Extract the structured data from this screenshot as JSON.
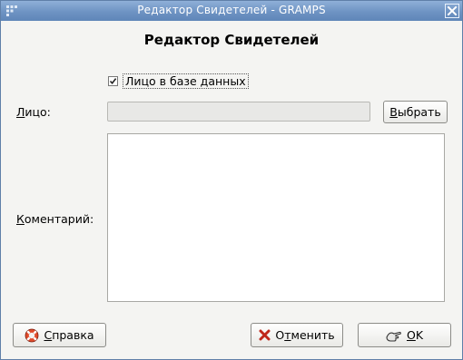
{
  "window": {
    "title": "Редактор Свидетелей - GRAMPS",
    "menu_icon": "window-menu-icon",
    "close_icon": "close-icon"
  },
  "dialog": {
    "heading": "Редактор Свидетелей",
    "in_database": {
      "label": "Лицо в базе данных",
      "checked": true
    },
    "person": {
      "label": "Лицо:",
      "value": "",
      "select_button": "Выбрать"
    },
    "comment": {
      "label": "Коментарий:",
      "value": ""
    }
  },
  "buttons": {
    "help": {
      "label": "Справка",
      "icon": "help-lifebuoy-icon"
    },
    "cancel": {
      "label": "Отменить",
      "icon": "cancel-x-icon"
    },
    "ok": {
      "label": "OK",
      "icon": "ok-hand-icon"
    }
  },
  "colors": {
    "titlebar": "#6e93c3",
    "window_bg": "#f4f4f2"
  }
}
